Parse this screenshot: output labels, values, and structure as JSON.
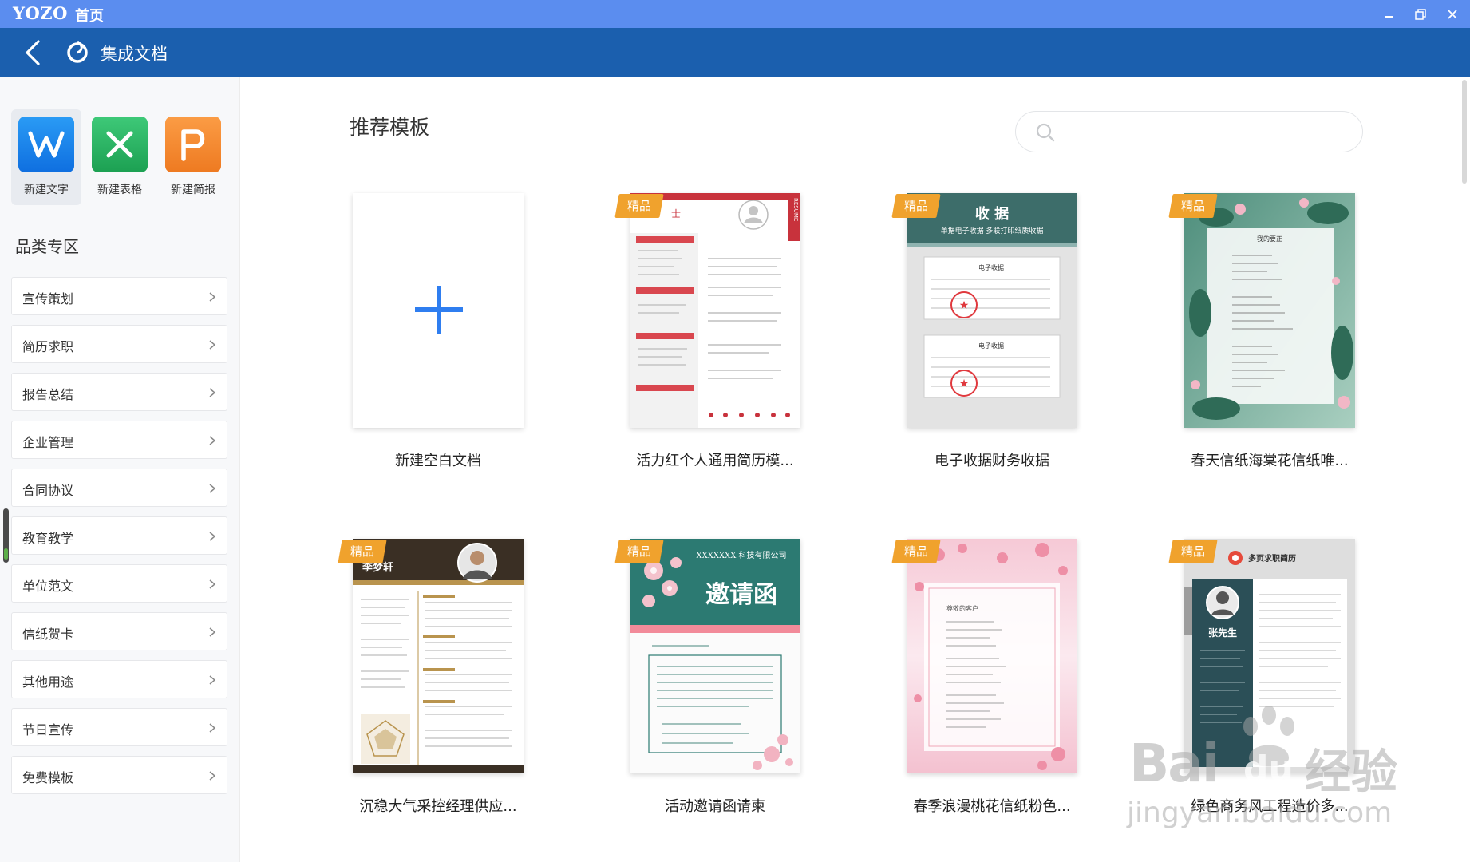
{
  "titlebar": {
    "brand": "YOZO",
    "home_label": "首页"
  },
  "header": {
    "title": "集成文档"
  },
  "new_docs": [
    {
      "label": "新建文字",
      "color": "#1a87f0",
      "icon": "writer-icon"
    },
    {
      "label": "新建表格",
      "color": "#29b562",
      "icon": "spreadsheet-icon"
    },
    {
      "label": "新建简报",
      "color": "#f48a32",
      "icon": "presentation-icon"
    }
  ],
  "sidebar": {
    "section_title": "品类专区",
    "categories": [
      "宣传策划",
      "简历求职",
      "报告总结",
      "企业管理",
      "合同协议",
      "教育教学",
      "单位范文",
      "信纸贺卡",
      "其他用途",
      "节日宣传",
      "免费模板"
    ]
  },
  "main": {
    "title": "推荐模板",
    "search_placeholder": "",
    "badge_label": "精品",
    "templates": [
      {
        "caption": "新建空白文档",
        "badge": false
      },
      {
        "caption": "活力红个人通用简历模...",
        "badge": true
      },
      {
        "caption": "电子收据财务收据",
        "badge": true
      },
      {
        "caption": "春天信纸海棠花信纸唯...",
        "badge": true
      },
      {
        "caption": "沉稳大气采控经理供应...",
        "badge": true
      },
      {
        "caption": "活动邀请函请柬",
        "badge": true
      },
      {
        "caption": "春季浪漫桃花信纸粉色...",
        "badge": true
      },
      {
        "caption": "绿色商务风工程造价多...",
        "badge": true
      }
    ]
  },
  "thumbs": {
    "resume_red": {
      "name": "士",
      "tag": "RESUME"
    },
    "receipt": {
      "title": "收 据",
      "subtitle": "单据电子收据 多联打印纸质收据",
      "doc_title": "电子收据"
    },
    "letter_spring": {
      "heading": "我的要正"
    },
    "resume_gold": {
      "name": "李梦轩"
    },
    "invitation": {
      "company": "XXXXXXX 科技有限公司",
      "title": "邀请函"
    },
    "letter_peach": {
      "heading": "尊敬的客户"
    },
    "resume_green": {
      "title": "多页求职简历",
      "name": "张先生"
    }
  },
  "watermark": {
    "brand": "Bai",
    "logo": "du",
    "cn": "经验",
    "url": "jingyan.baidu.com"
  }
}
